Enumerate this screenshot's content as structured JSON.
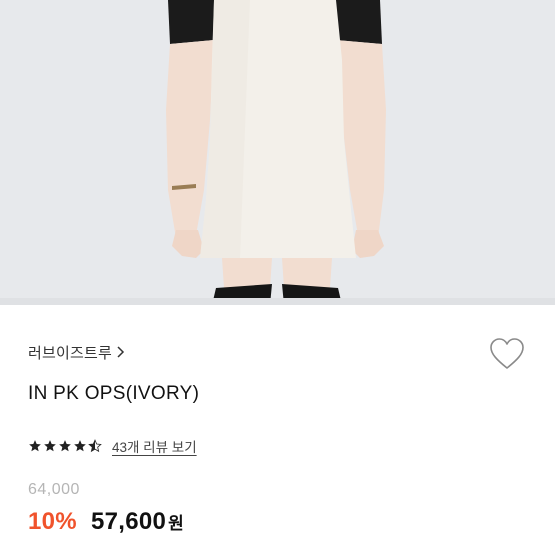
{
  "product": {
    "brand": "러브이즈트루",
    "title": "IN PK OPS(IVORY)",
    "rating": 4.5,
    "rating_max": 5,
    "review_link": "43개 리뷰 보기",
    "original_price": "64,000",
    "discount": "10%",
    "sale_price": "57,600",
    "currency": "원"
  },
  "colors": {
    "discount": "#f0532c",
    "star": "#222222",
    "original_price": "#b5b5b5"
  },
  "icons": {
    "brand_chevron": "chevron-right-icon",
    "wishlist": "heart-outline-icon"
  }
}
